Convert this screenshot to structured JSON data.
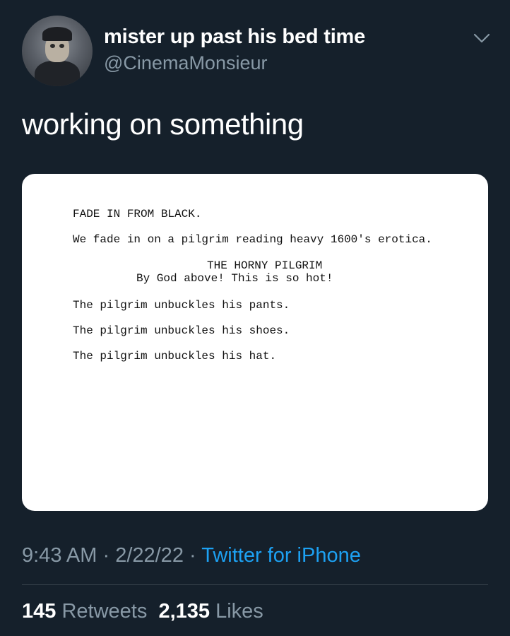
{
  "header": {
    "display_name": "mister up past his bed time",
    "handle": "@CinemaMonsieur",
    "menu_icon": "chevron-down-icon",
    "avatar_icon": "avatar"
  },
  "tweet": {
    "text": "working on something"
  },
  "screenplay": {
    "fade": "FADE IN FROM BLACK.",
    "action": "We fade in on a pilgrim reading heavy 1600's erotica.",
    "character": "THE HORNY PILGRIM",
    "dialogue": "By God above! This is so hot!",
    "actions": [
      "The pilgrim unbuckles his pants.",
      "The pilgrim unbuckles his shoes.",
      "The pilgrim unbuckles his hat."
    ]
  },
  "meta": {
    "time": "9:43 AM",
    "sep1": " · ",
    "date": "2/22/22",
    "sep2": " · ",
    "source": "Twitter for iPhone"
  },
  "stats": {
    "retweets_count": "145",
    "retweets_label": "Retweets",
    "likes_count": "2,135",
    "likes_label": "Likes"
  },
  "colors": {
    "background": "#15202b",
    "secondary_text": "#8899a6",
    "link": "#1da1f2"
  }
}
